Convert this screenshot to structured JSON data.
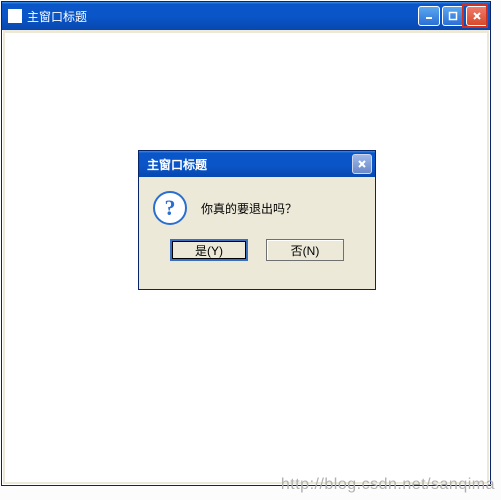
{
  "main_window": {
    "title": "主窗口标题",
    "buttons": {
      "minimize_name": "minimize-button",
      "maximize_name": "maximize-button",
      "close_name": "close-button"
    }
  },
  "dialog": {
    "title": "主窗口标题",
    "icon_name": "question-icon",
    "icon_glyph": "?",
    "message": "你真的要退出吗？",
    "buttons": {
      "yes": "是(Y)",
      "no": "否(N)"
    }
  },
  "watermark": "http://blog.csdn.net/sanqima"
}
